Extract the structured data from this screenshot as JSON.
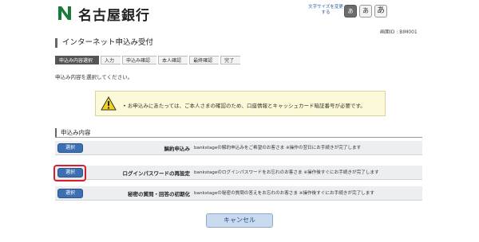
{
  "header": {
    "bank_name": "名古屋銀行",
    "font_size_label": "文字サイズを変更する",
    "font_size_small": "あ",
    "font_size_medium": "あ",
    "font_size_large": "あ",
    "screen_id": "画面ID : BIM001"
  },
  "page": {
    "title": "インターネット申込み受付",
    "instruction": "申込み内容を選択してください。"
  },
  "steps": [
    {
      "label": "申込み内容選択",
      "active": true
    },
    {
      "label": "入力",
      "active": false
    },
    {
      "label": "申込み確認",
      "active": false
    },
    {
      "label": "本人確認",
      "active": false
    },
    {
      "label": "最終確認",
      "active": false
    },
    {
      "label": "完了",
      "active": false
    }
  ],
  "notice": {
    "text": "•  お申込みにあたっては、ご本人さまの確認のため、口座情報とキャッシュカード暗証番号が必要です。"
  },
  "section": {
    "title": "申込み内容"
  },
  "options": [
    {
      "button": "選択",
      "title": "解約申込み",
      "desc": "bankstageの解約申込みをご希望のお客さま ※操作の翌日にお手続きが完了します"
    },
    {
      "button": "選択",
      "title": "ログインパスワードの再設定",
      "desc": "bankstageのログインパスワードをお忘れのお客さま ※操作後すぐにお手続きが完了します"
    },
    {
      "button": "選択",
      "title": "秘密の質問・回答の初期化",
      "desc": "bankstageの秘密の質問の答えをお忘れのお客さま ※操作後すぐにお手続きが完了します"
    }
  ],
  "footer": {
    "cancel_label": "キャンセル"
  },
  "colors": {
    "brand_green": "#1a7a3a",
    "button_blue": "#3e6fb0",
    "highlight_red": "#d8202a",
    "notice_bg": "#fbf9d8"
  }
}
